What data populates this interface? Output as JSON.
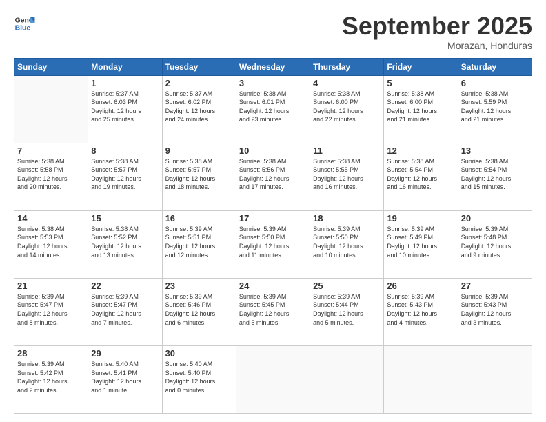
{
  "header": {
    "logo_line1": "General",
    "logo_line2": "Blue",
    "month": "September 2025",
    "location": "Morazan, Honduras"
  },
  "weekdays": [
    "Sunday",
    "Monday",
    "Tuesday",
    "Wednesday",
    "Thursday",
    "Friday",
    "Saturday"
  ],
  "weeks": [
    [
      {
        "day": "",
        "info": ""
      },
      {
        "day": "1",
        "info": "Sunrise: 5:37 AM\nSunset: 6:03 PM\nDaylight: 12 hours\nand 25 minutes."
      },
      {
        "day": "2",
        "info": "Sunrise: 5:37 AM\nSunset: 6:02 PM\nDaylight: 12 hours\nand 24 minutes."
      },
      {
        "day": "3",
        "info": "Sunrise: 5:38 AM\nSunset: 6:01 PM\nDaylight: 12 hours\nand 23 minutes."
      },
      {
        "day": "4",
        "info": "Sunrise: 5:38 AM\nSunset: 6:00 PM\nDaylight: 12 hours\nand 22 minutes."
      },
      {
        "day": "5",
        "info": "Sunrise: 5:38 AM\nSunset: 6:00 PM\nDaylight: 12 hours\nand 21 minutes."
      },
      {
        "day": "6",
        "info": "Sunrise: 5:38 AM\nSunset: 5:59 PM\nDaylight: 12 hours\nand 21 minutes."
      }
    ],
    [
      {
        "day": "7",
        "info": "Sunrise: 5:38 AM\nSunset: 5:58 PM\nDaylight: 12 hours\nand 20 minutes."
      },
      {
        "day": "8",
        "info": "Sunrise: 5:38 AM\nSunset: 5:57 PM\nDaylight: 12 hours\nand 19 minutes."
      },
      {
        "day": "9",
        "info": "Sunrise: 5:38 AM\nSunset: 5:57 PM\nDaylight: 12 hours\nand 18 minutes."
      },
      {
        "day": "10",
        "info": "Sunrise: 5:38 AM\nSunset: 5:56 PM\nDaylight: 12 hours\nand 17 minutes."
      },
      {
        "day": "11",
        "info": "Sunrise: 5:38 AM\nSunset: 5:55 PM\nDaylight: 12 hours\nand 16 minutes."
      },
      {
        "day": "12",
        "info": "Sunrise: 5:38 AM\nSunset: 5:54 PM\nDaylight: 12 hours\nand 16 minutes."
      },
      {
        "day": "13",
        "info": "Sunrise: 5:38 AM\nSunset: 5:54 PM\nDaylight: 12 hours\nand 15 minutes."
      }
    ],
    [
      {
        "day": "14",
        "info": "Sunrise: 5:38 AM\nSunset: 5:53 PM\nDaylight: 12 hours\nand 14 minutes."
      },
      {
        "day": "15",
        "info": "Sunrise: 5:38 AM\nSunset: 5:52 PM\nDaylight: 12 hours\nand 13 minutes."
      },
      {
        "day": "16",
        "info": "Sunrise: 5:39 AM\nSunset: 5:51 PM\nDaylight: 12 hours\nand 12 minutes."
      },
      {
        "day": "17",
        "info": "Sunrise: 5:39 AM\nSunset: 5:50 PM\nDaylight: 12 hours\nand 11 minutes."
      },
      {
        "day": "18",
        "info": "Sunrise: 5:39 AM\nSunset: 5:50 PM\nDaylight: 12 hours\nand 10 minutes."
      },
      {
        "day": "19",
        "info": "Sunrise: 5:39 AM\nSunset: 5:49 PM\nDaylight: 12 hours\nand 10 minutes."
      },
      {
        "day": "20",
        "info": "Sunrise: 5:39 AM\nSunset: 5:48 PM\nDaylight: 12 hours\nand 9 minutes."
      }
    ],
    [
      {
        "day": "21",
        "info": "Sunrise: 5:39 AM\nSunset: 5:47 PM\nDaylight: 12 hours\nand 8 minutes."
      },
      {
        "day": "22",
        "info": "Sunrise: 5:39 AM\nSunset: 5:47 PM\nDaylight: 12 hours\nand 7 minutes."
      },
      {
        "day": "23",
        "info": "Sunrise: 5:39 AM\nSunset: 5:46 PM\nDaylight: 12 hours\nand 6 minutes."
      },
      {
        "day": "24",
        "info": "Sunrise: 5:39 AM\nSunset: 5:45 PM\nDaylight: 12 hours\nand 5 minutes."
      },
      {
        "day": "25",
        "info": "Sunrise: 5:39 AM\nSunset: 5:44 PM\nDaylight: 12 hours\nand 5 minutes."
      },
      {
        "day": "26",
        "info": "Sunrise: 5:39 AM\nSunset: 5:43 PM\nDaylight: 12 hours\nand 4 minutes."
      },
      {
        "day": "27",
        "info": "Sunrise: 5:39 AM\nSunset: 5:43 PM\nDaylight: 12 hours\nand 3 minutes."
      }
    ],
    [
      {
        "day": "28",
        "info": "Sunrise: 5:39 AM\nSunset: 5:42 PM\nDaylight: 12 hours\nand 2 minutes."
      },
      {
        "day": "29",
        "info": "Sunrise: 5:40 AM\nSunset: 5:41 PM\nDaylight: 12 hours\nand 1 minute."
      },
      {
        "day": "30",
        "info": "Sunrise: 5:40 AM\nSunset: 5:40 PM\nDaylight: 12 hours\nand 0 minutes."
      },
      {
        "day": "",
        "info": ""
      },
      {
        "day": "",
        "info": ""
      },
      {
        "day": "",
        "info": ""
      },
      {
        "day": "",
        "info": ""
      }
    ]
  ]
}
